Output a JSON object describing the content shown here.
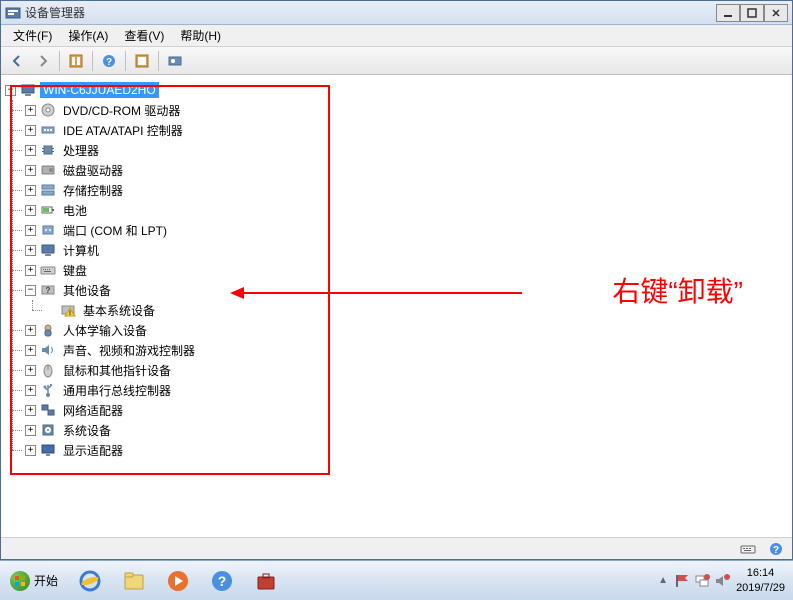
{
  "window": {
    "title": "设备管理器"
  },
  "menu": {
    "file": "文件(F)",
    "action": "操作(A)",
    "view": "查看(V)",
    "help": "帮助(H)"
  },
  "tree": {
    "root": "WIN-C6JJUAED2HO",
    "items": [
      {
        "label": "DVD/CD-ROM 驱动器",
        "icon": "disc"
      },
      {
        "label": "IDE ATA/ATAPI 控制器",
        "icon": "ide"
      },
      {
        "label": "处理器",
        "icon": "cpu"
      },
      {
        "label": "磁盘驱动器",
        "icon": "disk"
      },
      {
        "label": "存储控制器",
        "icon": "storage"
      },
      {
        "label": "电池",
        "icon": "battery"
      },
      {
        "label": "端口 (COM 和 LPT)",
        "icon": "port"
      },
      {
        "label": "计算机",
        "icon": "computer"
      },
      {
        "label": "键盘",
        "icon": "keyboard"
      },
      {
        "label": "其他设备",
        "icon": "unknown",
        "expanded": true,
        "children": [
          {
            "label": "基本系统设备",
            "icon": "warning"
          }
        ]
      },
      {
        "label": "人体学输入设备",
        "icon": "hid"
      },
      {
        "label": "声音、视频和游戏控制器",
        "icon": "sound"
      },
      {
        "label": "鼠标和其他指针设备",
        "icon": "mouse"
      },
      {
        "label": "通用串行总线控制器",
        "icon": "usb"
      },
      {
        "label": "网络适配器",
        "icon": "network"
      },
      {
        "label": "系统设备",
        "icon": "system"
      },
      {
        "label": "显示适配器",
        "icon": "display"
      }
    ]
  },
  "annotation": {
    "text": "右键“卸载”"
  },
  "taskbar": {
    "start": "开始",
    "time": "16:14",
    "date": "2019/7/29"
  }
}
